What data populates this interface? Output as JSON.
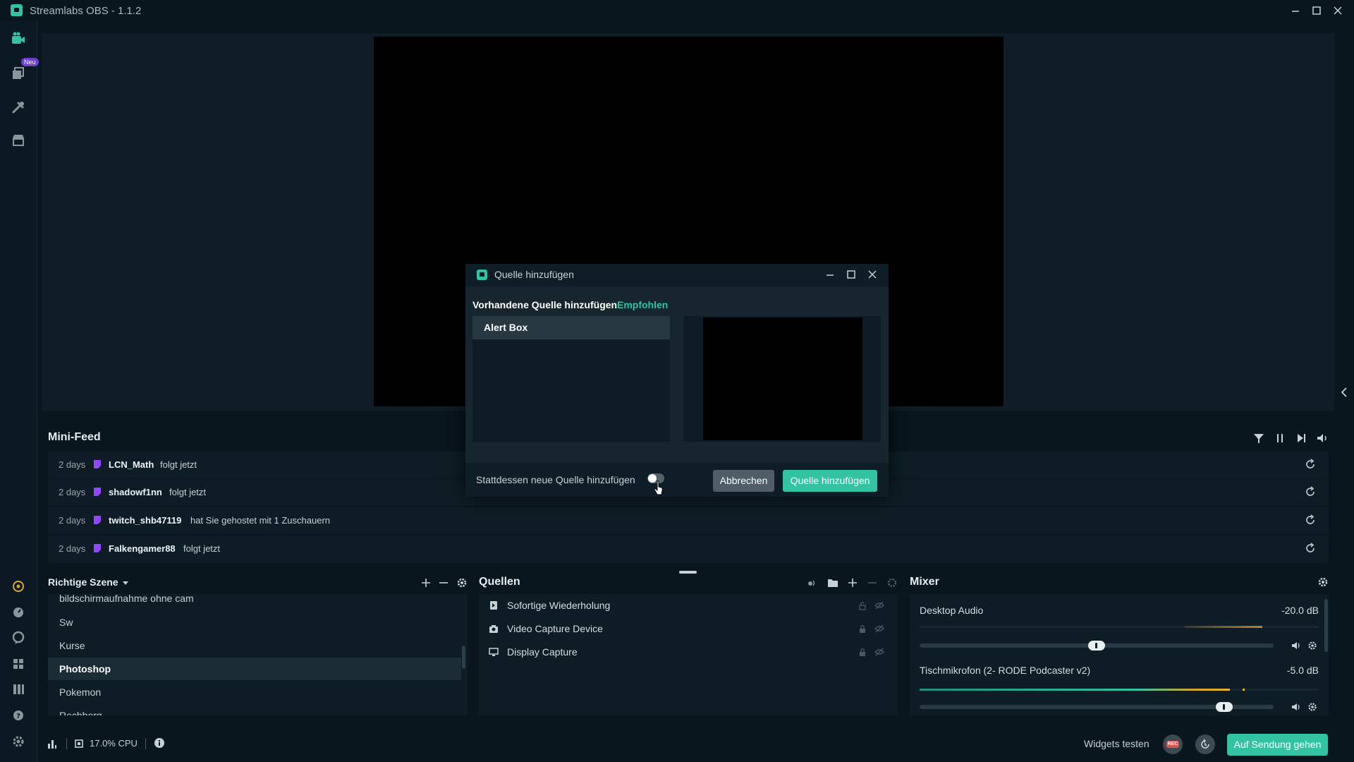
{
  "app": {
    "title": "Streamlabs OBS - 1.1.2"
  },
  "sidebar": {
    "badge": "Neu"
  },
  "minifeed": {
    "title": "Mini-Feed",
    "items": [
      {
        "time": "2 days",
        "user": "LCN_Math",
        "action": "folgt jetzt"
      },
      {
        "time": "2 days",
        "user": "shadowf1nn",
        "action": "folgt jetzt"
      },
      {
        "time": "2 days",
        "user": "twitch_shb47119",
        "action": "hat Sie gehostet mit 1 Zuschauern"
      },
      {
        "time": "2 days",
        "user": "Falkengamer88",
        "action": "folgt jetzt"
      }
    ]
  },
  "scenes": {
    "title": "Richtige Szene",
    "items": [
      "bildschirmaufnahme ohne cam",
      "Sw",
      "Kurse",
      "Photoshop",
      "Pokemon",
      "Rechberg"
    ],
    "active": "Photoshop"
  },
  "sources": {
    "title": "Quellen",
    "items": [
      {
        "label": "Sofortige Wiederholung",
        "icon": "replay-icon"
      },
      {
        "label": "Video Capture Device",
        "icon": "camera-icon"
      },
      {
        "label": "Display Capture",
        "icon": "monitor-icon"
      }
    ]
  },
  "mixer": {
    "title": "Mixer",
    "channels": [
      {
        "name": "Desktop Audio",
        "db": "-20.0 dB",
        "volume": 0.5
      },
      {
        "name": "Tischmikrofon (2- RODE Podcaster v2)",
        "db": "-5.0 dB",
        "volume": 0.86
      }
    ]
  },
  "footer": {
    "cpu": "17.0% CPU",
    "widgets_label": "Widgets testen",
    "rec_label": "REC",
    "go_live": "Auf Sendung gehen"
  },
  "modal": {
    "title": "Quelle hinzufügen",
    "heading": "Vorhandene Quelle hinzufügen",
    "recommended": "Empfohlen",
    "list_item": "Alert Box",
    "toggle_label": "Stattdessen neue Quelle hinzufügen",
    "cancel": "Abbrechen",
    "confirm": "Quelle hinzufügen"
  },
  "colors": {
    "accent": "#31c3a2",
    "background": "#09161d",
    "panel": "#0e1d25",
    "twitch": "#9146ff",
    "rec": "#d9534f"
  }
}
